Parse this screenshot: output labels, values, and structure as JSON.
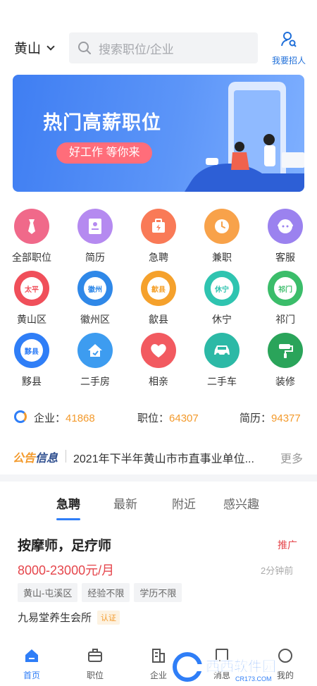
{
  "header": {
    "city": "黄山",
    "search_placeholder": "搜索职位/企业",
    "recruit_label": "我要招人"
  },
  "banner": {
    "title": "热门高薪职位",
    "pill": "好工作 等你来",
    "colors": {
      "background": "#4a86f5",
      "pill": "#ff6d7a"
    }
  },
  "grid": {
    "rows": [
      [
        {
          "label": "全部职位",
          "icon": "tie-icon",
          "color": "#f0698a"
        },
        {
          "label": "简历",
          "icon": "resume-icon",
          "color": "#b58af0"
        },
        {
          "label": "急聘",
          "icon": "urgent-bag-icon",
          "color": "#f97a57"
        },
        {
          "label": "兼职",
          "icon": "clock-icon",
          "color": "#f8a24a"
        },
        {
          "label": "客服",
          "icon": "agent-icon",
          "color": "#9b82ef"
        }
      ],
      [
        {
          "label": "黄山区",
          "badge": "太平",
          "color": "#f04f5a"
        },
        {
          "label": "徽州区",
          "badge": "徽州",
          "color": "#2f88e8"
        },
        {
          "label": "歙县",
          "badge": "歙县",
          "color": "#f5a12c"
        },
        {
          "label": "休宁",
          "badge": "休宁",
          "color": "#2fc4b0"
        },
        {
          "label": "祁门",
          "badge": "祁门",
          "color": "#3bbd6a"
        }
      ],
      [
        {
          "label": "黟县",
          "badge": "黟县",
          "color": "#2f7ef7"
        },
        {
          "label": "二手房",
          "icon": "house-icon",
          "color": "#3d9cf0"
        },
        {
          "label": "相亲",
          "icon": "heart-icon",
          "color": "#f25a60"
        },
        {
          "label": "二手车",
          "icon": "car-icon",
          "color": "#2cb9a6"
        },
        {
          "label": "装修",
          "icon": "paint-roller-icon",
          "color": "#2aa45a"
        }
      ]
    ]
  },
  "stats": {
    "company_label": "企业：",
    "company_value": "41868",
    "job_label": "职位：",
    "job_value": "64307",
    "resume_label": "简历：",
    "resume_value": "94377"
  },
  "notice": {
    "tag_a": "公告",
    "tag_b": "信息",
    "text": "2021年下半年黄山市市直事业单位...",
    "more": "更多"
  },
  "tabs": [
    "急聘",
    "最新",
    "附近",
    "感兴趣"
  ],
  "job": {
    "title": "按摩师，足疗师",
    "promo": "推广",
    "salary": "8000-23000元/月",
    "time": "2分钟前",
    "tags": [
      "黄山-屯溪区",
      "经验不限",
      "学历不限"
    ],
    "company": "九易堂养生会所",
    "badge": "认证"
  },
  "bottomnav": [
    {
      "label": "首页",
      "icon": "home-icon"
    },
    {
      "label": "职位",
      "icon": "briefcase-icon"
    },
    {
      "label": "企业",
      "icon": "building-icon"
    },
    {
      "label": "消息",
      "icon": "message-icon"
    },
    {
      "label": "我的",
      "icon": "user-icon"
    }
  ],
  "watermark": {
    "brand": "西西软件园",
    "url": "CR173.COM"
  },
  "colors": {
    "accent": "#2f7ef7",
    "orange": "#f39a2c",
    "red": "#e5454b"
  }
}
